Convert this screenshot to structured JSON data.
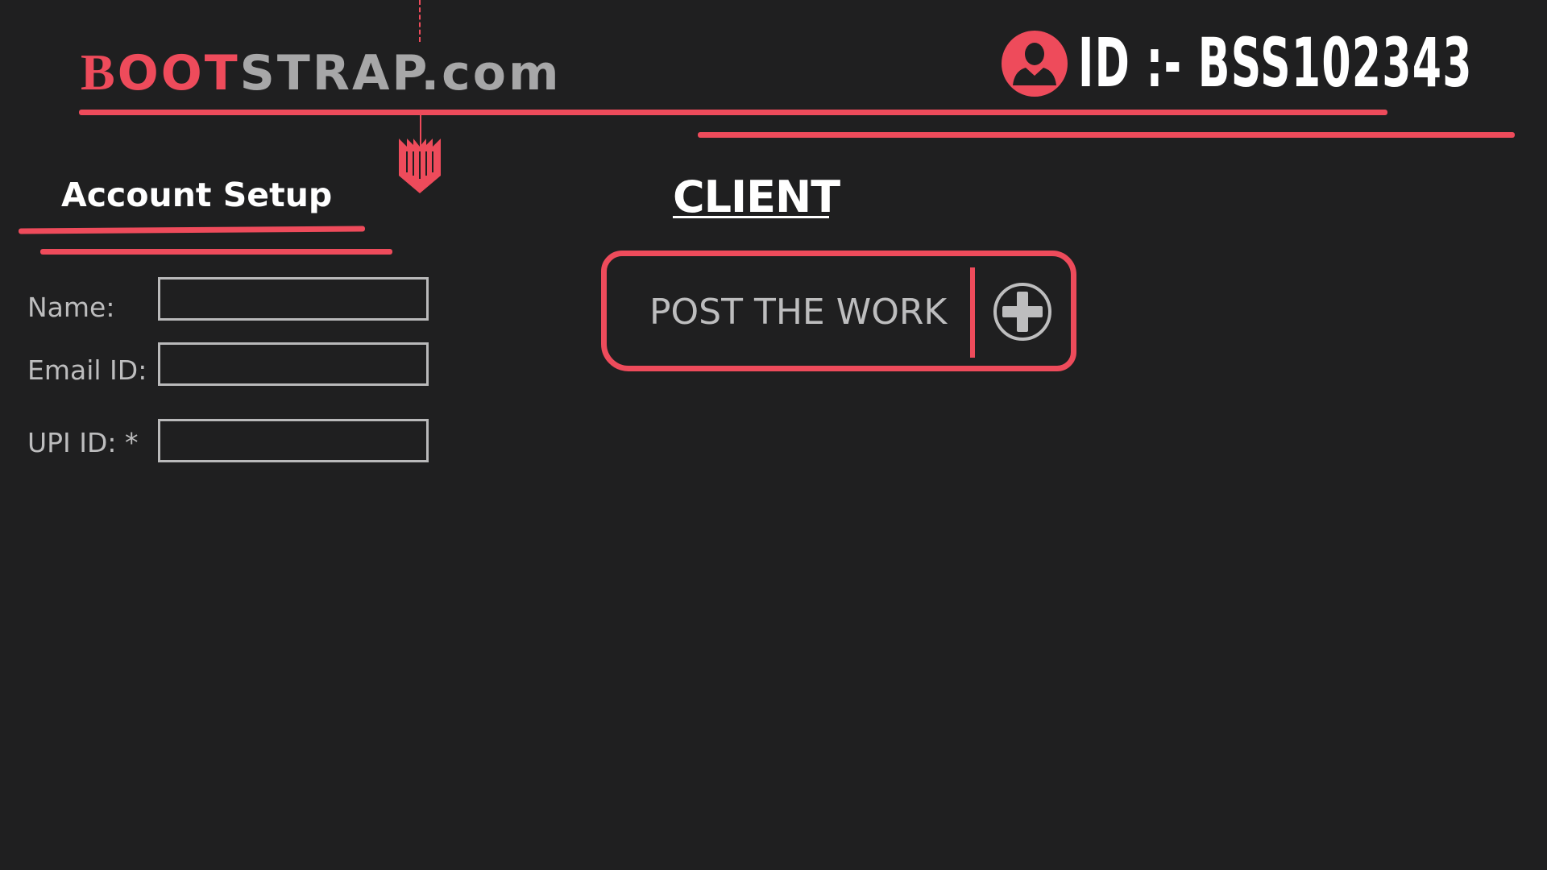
{
  "header": {
    "logo": {
      "part1": "B",
      "part2": "OOT",
      "part3": "STRAP.com"
    },
    "user": {
      "icon": "user-avatar-icon",
      "id_text": "ID :- BSS102343"
    }
  },
  "account_setup": {
    "title": "Account Setup",
    "fields": [
      {
        "label": "Name:",
        "value": ""
      },
      {
        "label": "Email ID:",
        "value": ""
      },
      {
        "label": "UPI ID: *",
        "value": ""
      }
    ]
  },
  "client": {
    "title": "CLIENT",
    "post_button": {
      "label": "POST THE WORK",
      "icon": "plus-circle-icon"
    }
  },
  "colors": {
    "accent": "#ee4b5b",
    "background": "#1f1f20",
    "muted_text": "#bdbdbe",
    "logo_gray": "#a7a7a8"
  }
}
